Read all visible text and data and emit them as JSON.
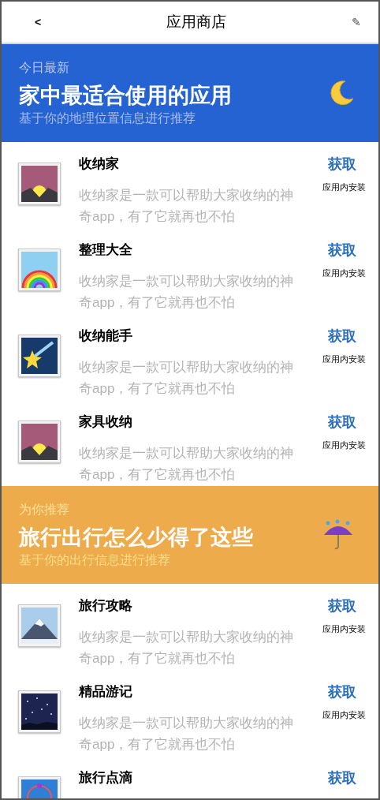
{
  "header": {
    "back": "<",
    "title": "应用商店",
    "edit": "✎"
  },
  "sections": [
    {
      "kind": "blue",
      "eyebrow": "今日最新",
      "headline": "家中最适合使用的应用",
      "subtitle": "基于你的地理位置信息进行推荐",
      "apps": [
        {
          "name": "收纳家",
          "description": "收纳家是一款可以帮助大家收纳的神奇app，有了它就再也不怕",
          "action": "获取",
          "note": "应用内安装"
        },
        {
          "name": "整理大全",
          "description": "收纳家是一款可以帮助大家收纳的神奇app，有了它就再也不怕",
          "action": "获取",
          "note": "应用内安装"
        },
        {
          "name": "收纳能手",
          "description": "收纳家是一款可以帮助大家收纳的神奇app，有了它就再也不怕",
          "action": "获取",
          "note": "应用内安装"
        },
        {
          "name": "家具收纳",
          "description": "收纳家是一款可以帮助大家收纳的神奇app，有了它就再也不怕",
          "action": "获取",
          "note": "应用内安装"
        }
      ]
    },
    {
      "kind": "orange",
      "eyebrow": "为你推荐",
      "headline": "旅行出行怎么少得了这些",
      "subtitle": "基于你的出行信息进行推荐",
      "apps": [
        {
          "name": "旅行攻略",
          "description": "收纳家是一款可以帮助大家收纳的神奇app，有了它就再也不怕",
          "action": "获取",
          "note": "应用内安装"
        },
        {
          "name": "精品游记",
          "description": "收纳家是一款可以帮助大家收纳的神奇app，有了它就再也不怕",
          "action": "获取",
          "note": "应用内安装"
        },
        {
          "name": "旅行点滴",
          "action": "获取"
        }
      ]
    }
  ]
}
